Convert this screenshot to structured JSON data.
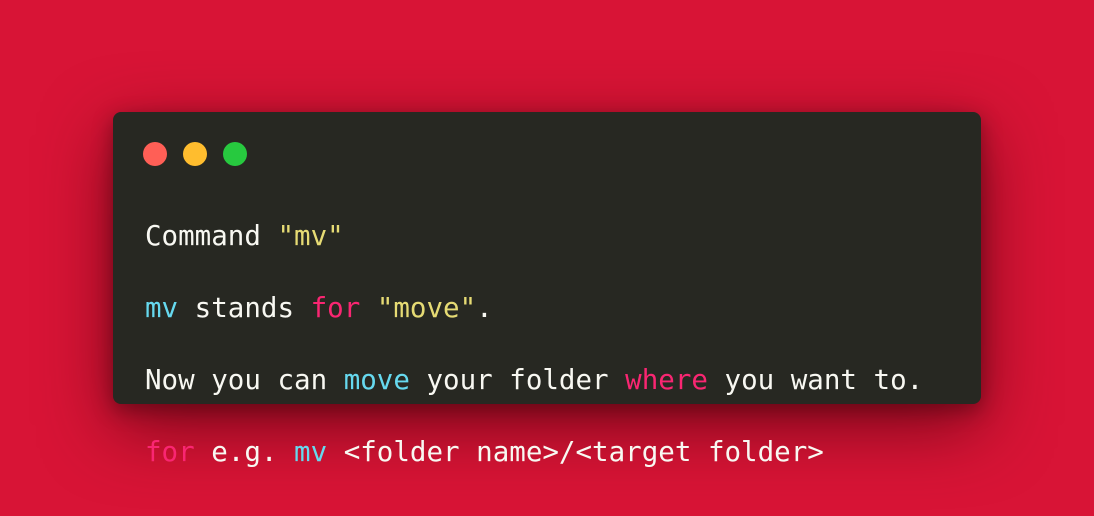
{
  "window": {
    "controls": {
      "close": {
        "color": "#ff5f56"
      },
      "minimize": {
        "color": "#ffbd2e"
      },
      "maximize": {
        "color": "#27c93f"
      }
    }
  },
  "colors": {
    "background": "#d81436",
    "editor": "#272822",
    "plain": "#f8f8f2",
    "string": "#e6db74",
    "function": "#66d9ef",
    "keyword": "#f92672"
  },
  "code": {
    "lines": [
      [
        {
          "text": "Command ",
          "kind": "plain"
        },
        {
          "text": "\"mv\"",
          "kind": "string"
        }
      ],
      [
        {
          "text": "mv",
          "kind": "func"
        },
        {
          "text": " stands ",
          "kind": "plain"
        },
        {
          "text": "for",
          "kind": "keyword"
        },
        {
          "text": " ",
          "kind": "plain"
        },
        {
          "text": "\"move\"",
          "kind": "string"
        },
        {
          "text": ".",
          "kind": "plain"
        }
      ],
      [
        {
          "text": "Now you can ",
          "kind": "plain"
        },
        {
          "text": "move",
          "kind": "func"
        },
        {
          "text": " your folder ",
          "kind": "plain"
        },
        {
          "text": "where",
          "kind": "keyword"
        },
        {
          "text": " you want to.",
          "kind": "plain"
        }
      ],
      [
        {
          "text": "for",
          "kind": "keyword"
        },
        {
          "text": " e.g. ",
          "kind": "plain"
        },
        {
          "text": "mv",
          "kind": "func"
        },
        {
          "text": " <folder name>/<target folder>",
          "kind": "plain"
        }
      ]
    ]
  }
}
